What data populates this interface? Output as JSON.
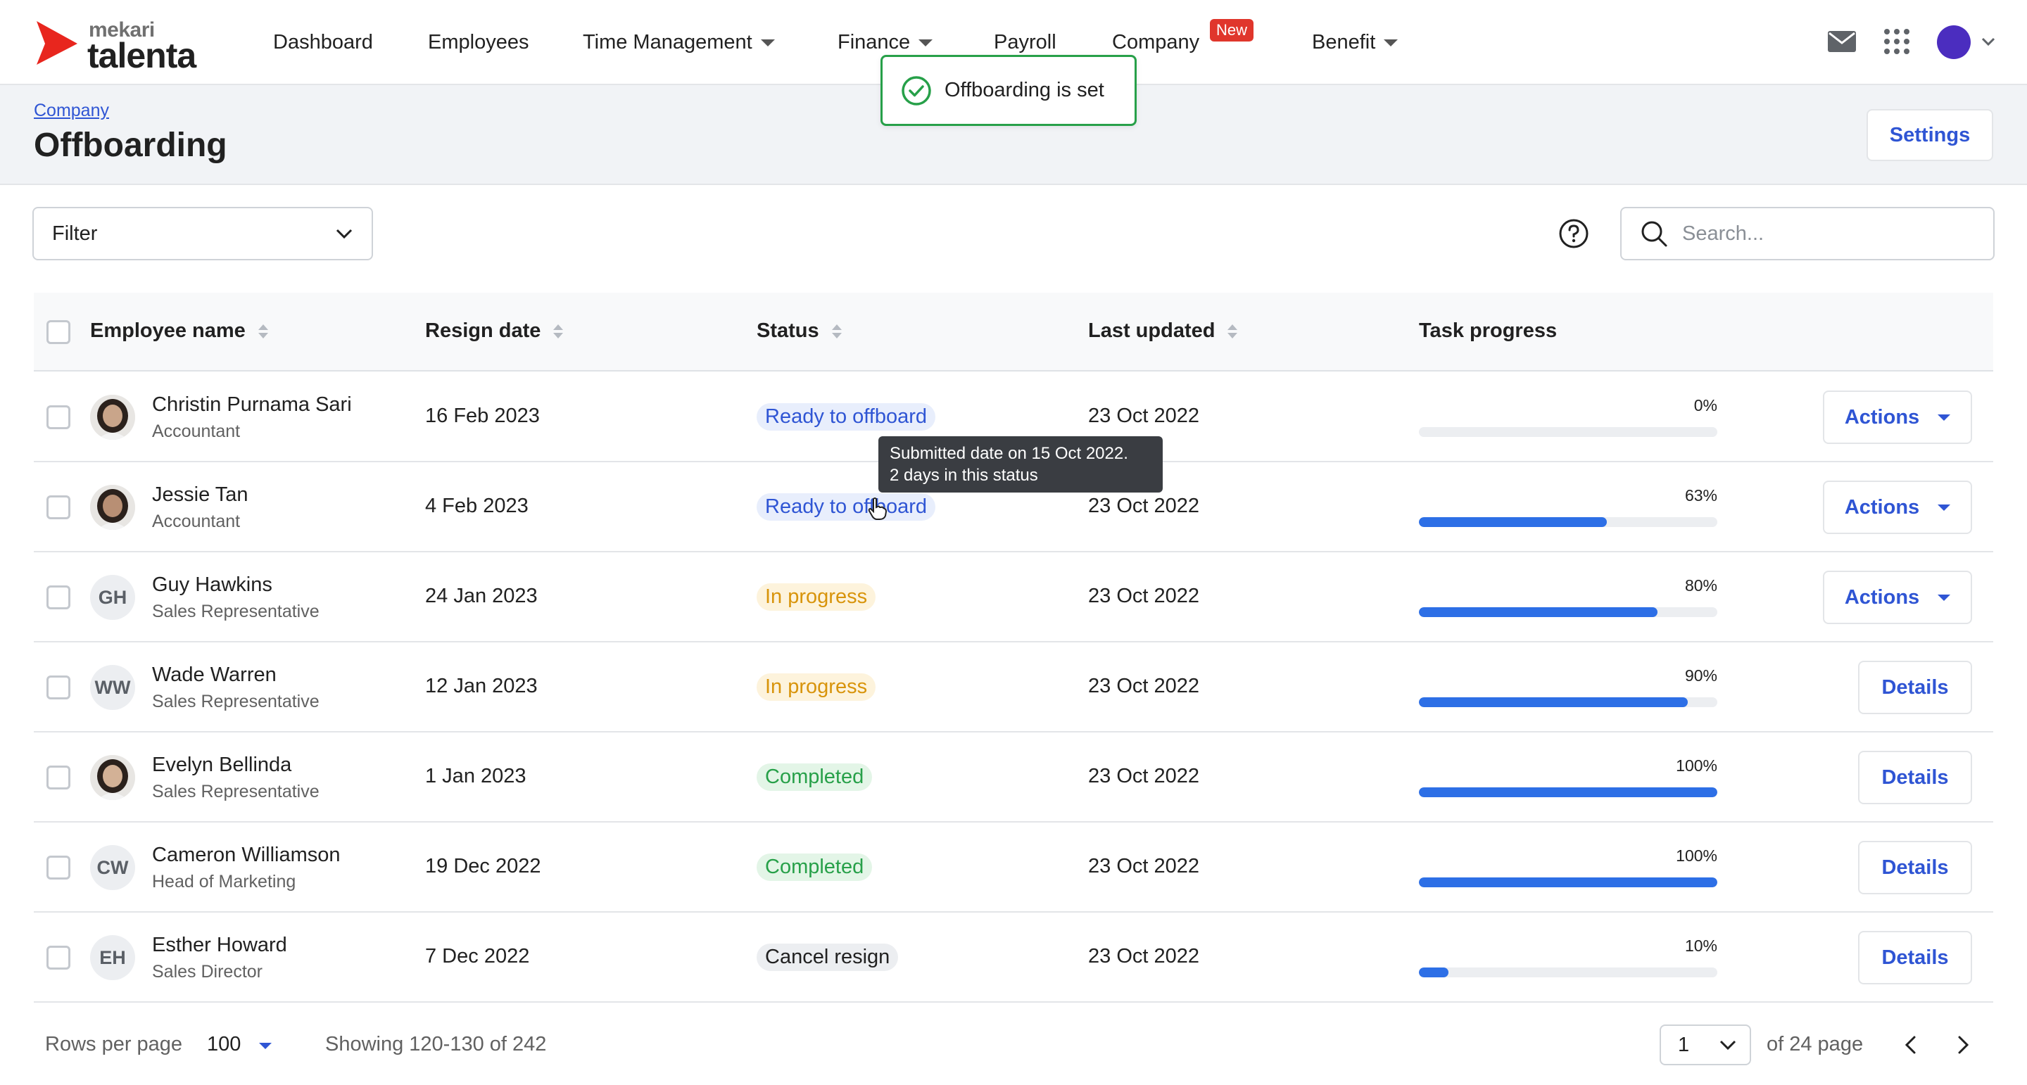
{
  "brand": {
    "small": "mekari",
    "large": "talenta"
  },
  "nav": {
    "items": [
      {
        "label": "Dashboard",
        "caret": false
      },
      {
        "label": "Employees",
        "caret": false
      },
      {
        "label": "Time Management",
        "caret": true
      },
      {
        "label": "Finance",
        "caret": true
      },
      {
        "label": "Payroll",
        "caret": false
      },
      {
        "label": "Company",
        "caret": false
      },
      {
        "label": "Benefit",
        "caret": true
      }
    ],
    "new_badge": "New",
    "icons": [
      "mail-icon",
      "apps-grid-icon",
      "user-avatar",
      "chevron-down-icon"
    ]
  },
  "header": {
    "breadcrumb": "Company",
    "title": "Offboarding",
    "settings_label": "Settings"
  },
  "toast": {
    "message": "Offboarding is set"
  },
  "toolbar": {
    "filter_label": "Filter",
    "search_placeholder": "Search..."
  },
  "table": {
    "columns": [
      "Employee name",
      "Resign date",
      "Status",
      "Last updated",
      "Task progress"
    ],
    "rows": [
      {
        "name": "Christin Purnama Sari",
        "role": "Accountant",
        "initials": "",
        "photo": true,
        "resign_date": "16 Feb 2023",
        "status": "Ready to offboard",
        "status_type": "ready",
        "last_updated": "23 Oct 2022",
        "progress": 0,
        "progress_label": "0%",
        "action": "Actions"
      },
      {
        "name": "Jessie Tan",
        "role": "Accountant",
        "initials": "",
        "photo": true,
        "resign_date": "4 Feb 2023",
        "status": "Ready to offboard",
        "status_type": "ready",
        "last_updated": "23 Oct 2022",
        "progress": 63,
        "progress_label": "63%",
        "action": "Actions"
      },
      {
        "name": "Guy Hawkins",
        "role": "Sales Representative",
        "initials": "GH",
        "photo": false,
        "resign_date": "24 Jan 2023",
        "status": "In progress",
        "status_type": "progress",
        "last_updated": "23 Oct 2022",
        "progress": 80,
        "progress_label": "80%",
        "action": "Actions"
      },
      {
        "name": "Wade Warren",
        "role": "Sales Representative",
        "initials": "WW",
        "photo": false,
        "resign_date": "12 Jan 2023",
        "status": "In progress",
        "status_type": "progress",
        "last_updated": "23 Oct 2022",
        "progress": 90,
        "progress_label": "90%",
        "action": "Details"
      },
      {
        "name": "Evelyn Bellinda",
        "role": "Sales Representative",
        "initials": "",
        "photo": true,
        "resign_date": "1 Jan 2023",
        "status": "Completed",
        "status_type": "completed",
        "last_updated": "23 Oct 2022",
        "progress": 100,
        "progress_label": "100%",
        "action": "Details"
      },
      {
        "name": "Cameron Williamson",
        "role": "Head of Marketing",
        "initials": "CW",
        "photo": false,
        "resign_date": "19 Dec 2022",
        "status": "Completed",
        "status_type": "completed",
        "last_updated": "23 Oct 2022",
        "progress": 100,
        "progress_label": "100%",
        "action": "Details"
      },
      {
        "name": "Esther Howard",
        "role": "Sales Director",
        "initials": "EH",
        "photo": false,
        "resign_date": "7 Dec 2022",
        "status": "Cancel resign",
        "status_type": "cancel",
        "last_updated": "23 Oct 2022",
        "progress": 10,
        "progress_label": "10%",
        "action": "Details"
      }
    ]
  },
  "tooltip": {
    "line1": "Submitted date on 15 Oct 2022.",
    "line2": "2 days in this status"
  },
  "footer": {
    "rows_per_page_label": "Rows per page",
    "rows_per_page_value": "100",
    "showing": "Showing 120-130 of 242",
    "current_page": "1",
    "of_pages": "of 24 page"
  },
  "colors": {
    "accent": "#2f55d4",
    "progress_fill": "#2d6fe6",
    "success": "#27a049",
    "warning": "#d8940b",
    "logo_red": "#e8261e",
    "new_badge": "#e0362c"
  }
}
